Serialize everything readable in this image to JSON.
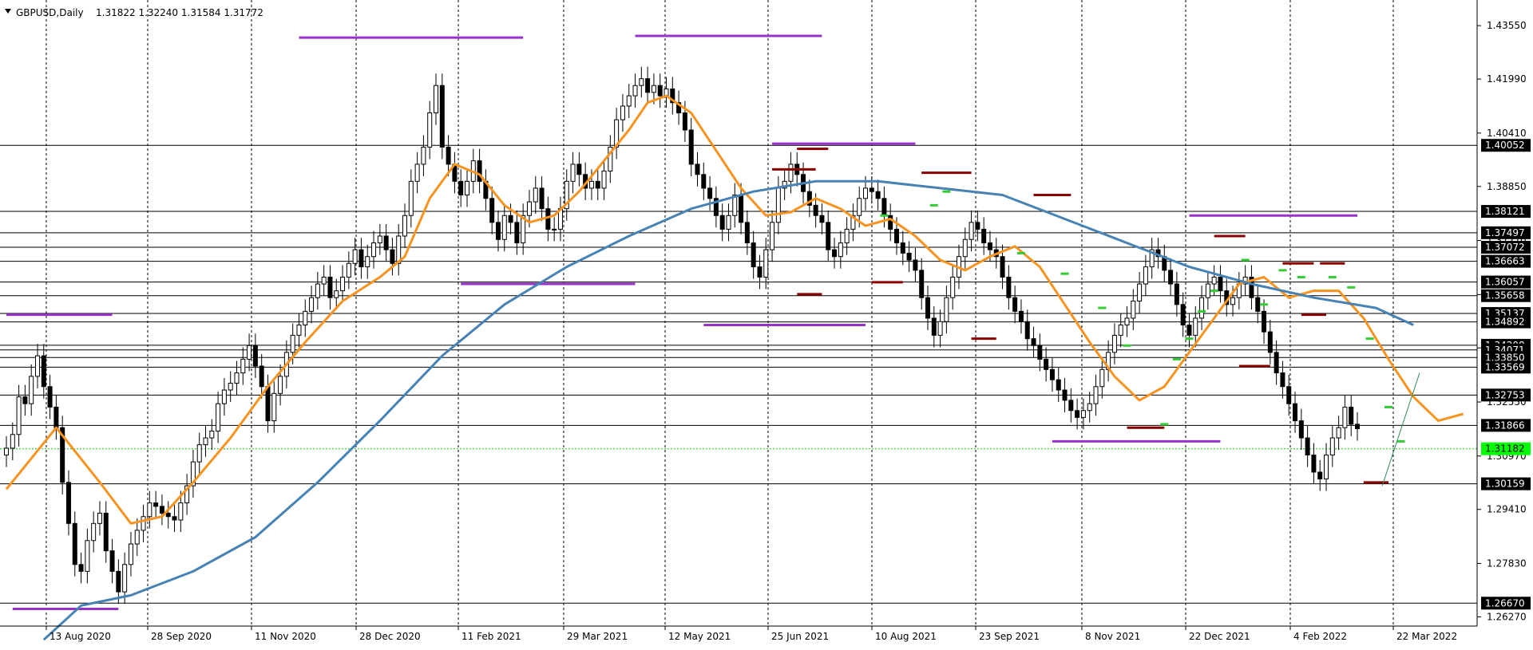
{
  "window": {
    "symbol_title": "GBPUSD,Daily",
    "ohlc": "1.31822 1.32240 1.31584 1.31772",
    "menu_arrow_icon": "triangle-down-icon"
  },
  "colors": {
    "background": "#ffffff",
    "grid": "#000000",
    "candle": "#000000",
    "ma_fast": "#f7931e",
    "ma_slow": "#4682b4",
    "level_line": "#000000",
    "purple_zone": "#9932cc",
    "resistance_marker": "#8b0000",
    "fractal_up": "#32cd32",
    "current_price_bg": "#00ff00",
    "label_bg": "#000000",
    "label_fg": "#ffffff",
    "trend_line": "#2e8b57"
  },
  "chart_data": {
    "type": "candlestick",
    "title": "GBPUSD,Daily",
    "symbol": "GBPUSD",
    "timeframe": "Daily",
    "last_ohlc": {
      "open": 1.31822,
      "high": 1.3224,
      "low": 1.31584,
      "close": 1.31772
    },
    "ylim": [
      1.26,
      1.443
    ],
    "grid": true,
    "y_ticks": [
      "1.43550",
      "1.41990",
      "1.40410",
      "1.38850",
      "1.37270",
      "1.35690",
      "1.34130",
      "1.32550",
      "1.30970",
      "1.29410",
      "1.27830",
      "1.26270"
    ],
    "x_ticks": [
      "13 Aug 2020",
      "28 Sep 2020",
      "11 Nov 2020",
      "28 Dec 2020",
      "11 Feb 2021",
      "29 Mar 2021",
      "12 May 2021",
      "25 Jun 2021",
      "10 Aug 2021",
      "23 Sep 2021",
      "8 Nov 2021",
      "22 Dec 2021",
      "4 Feb 2022",
      "22 Mar 2022"
    ],
    "price_levels": [
      "1.40052",
      "1.38121",
      "1.37497",
      "1.37072",
      "1.36663",
      "1.36057",
      "1.35658",
      "1.35137",
      "1.34892",
      "1.34208",
      "1.34071",
      "1.33850",
      "1.33569",
      "1.32753",
      "1.31866",
      "1.30159",
      "1.26670"
    ],
    "current_price": "1.31182",
    "close_series": [
      1.312,
      1.316,
      1.327,
      1.325,
      1.333,
      1.339,
      1.33,
      1.324,
      1.318,
      1.302,
      1.29,
      1.278,
      1.276,
      1.285,
      1.29,
      1.293,
      1.282,
      1.276,
      1.27,
      1.278,
      1.284,
      1.288,
      1.292,
      1.296,
      1.295,
      1.293,
      1.292,
      1.291,
      1.296,
      1.301,
      1.308,
      1.313,
      1.315,
      1.317,
      1.325,
      1.329,
      1.331,
      1.334,
      1.338,
      1.342,
      1.336,
      1.33,
      1.32,
      1.328,
      1.333,
      1.34,
      1.345,
      1.348,
      1.352,
      1.356,
      1.36,
      1.362,
      1.356,
      1.358,
      1.362,
      1.366,
      1.37,
      1.365,
      1.368,
      1.372,
      1.374,
      1.37,
      1.366,
      1.374,
      1.38,
      1.39,
      1.395,
      1.4,
      1.41,
      1.418,
      1.4,
      1.395,
      1.39,
      1.386,
      1.39,
      1.396,
      1.39,
      1.385,
      1.378,
      1.373,
      1.38,
      1.378,
      1.372,
      1.38,
      1.384,
      1.388,
      1.382,
      1.376,
      1.376,
      1.382,
      1.39,
      1.395,
      1.392,
      1.388,
      1.39,
      1.388,
      1.393,
      1.4,
      1.408,
      1.412,
      1.415,
      1.418,
      1.42,
      1.416,
      1.418,
      1.415,
      1.417,
      1.413,
      1.41,
      1.405,
      1.395,
      1.392,
      1.388,
      1.385,
      1.38,
      1.376,
      1.38,
      1.386,
      1.378,
      1.372,
      1.365,
      1.362,
      1.37,
      1.378,
      1.388,
      1.39,
      1.395,
      1.392,
      1.387,
      1.383,
      1.38,
      1.378,
      1.37,
      1.368,
      1.372,
      1.376,
      1.38,
      1.385,
      1.388,
      1.387,
      1.385,
      1.38,
      1.376,
      1.372,
      1.369,
      1.367,
      1.364,
      1.356,
      1.35,
      1.345,
      1.349,
      1.356,
      1.362,
      1.368,
      1.373,
      1.378,
      1.376,
      1.372,
      1.37,
      1.368,
      1.362,
      1.356,
      1.352,
      1.349,
      1.344,
      1.342,
      1.338,
      1.335,
      1.332,
      1.329,
      1.326,
      1.323,
      1.321,
      1.323,
      1.325,
      1.33,
      1.335,
      1.34,
      1.345,
      1.348,
      1.35,
      1.355,
      1.36,
      1.365,
      1.37,
      1.368,
      1.364,
      1.36,
      1.354,
      1.348,
      1.345,
      1.35,
      1.356,
      1.36,
      1.362,
      1.358,
      1.354,
      1.356,
      1.36,
      1.362,
      1.356,
      1.352,
      1.346,
      1.34,
      1.334,
      1.33,
      1.325,
      1.32,
      1.315,
      1.31,
      1.305,
      1.303,
      1.31,
      1.315,
      1.318,
      1.324,
      1.319,
      1.3177
    ],
    "moving_averages": [
      {
        "name": "",
        "color": "#f7931e",
        "points": [
          [
            0,
            1.3
          ],
          [
            8,
            1.318
          ],
          [
            15,
            1.302
          ],
          [
            20,
            1.29
          ],
          [
            25,
            1.292
          ],
          [
            30,
            1.302
          ],
          [
            36,
            1.315
          ],
          [
            42,
            1.33
          ],
          [
            48,
            1.343
          ],
          [
            54,
            1.355
          ],
          [
            60,
            1.362
          ],
          [
            64,
            1.368
          ],
          [
            68,
            1.385
          ],
          [
            72,
            1.395
          ],
          [
            76,
            1.392
          ],
          [
            80,
            1.383
          ],
          [
            84,
            1.378
          ],
          [
            88,
            1.38
          ],
          [
            92,
            1.387
          ],
          [
            96,
            1.396
          ],
          [
            100,
            1.405
          ],
          [
            103,
            1.413
          ],
          [
            106,
            1.415
          ],
          [
            110,
            1.41
          ],
          [
            114,
            1.399
          ],
          [
            118,
            1.388
          ],
          [
            122,
            1.38
          ],
          [
            126,
            1.381
          ],
          [
            130,
            1.385
          ],
          [
            134,
            1.382
          ],
          [
            138,
            1.377
          ],
          [
            142,
            1.379
          ],
          [
            146,
            1.374
          ],
          [
            150,
            1.367
          ],
          [
            154,
            1.364
          ],
          [
            158,
            1.368
          ],
          [
            162,
            1.371
          ],
          [
            166,
            1.365
          ],
          [
            170,
            1.354
          ],
          [
            174,
            1.343
          ],
          [
            178,
            1.333
          ],
          [
            182,
            1.326
          ],
          [
            186,
            1.33
          ],
          [
            190,
            1.34
          ],
          [
            194,
            1.35
          ],
          [
            198,
            1.36
          ],
          [
            202,
            1.362
          ],
          [
            206,
            1.356
          ],
          [
            210,
            1.358
          ],
          [
            214,
            1.358
          ],
          [
            218,
            1.35
          ],
          [
            222,
            1.338
          ],
          [
            226,
            1.327
          ],
          [
            230,
            1.32
          ],
          [
            234,
            1.322
          ]
        ]
      },
      {
        "name": "",
        "color": "#4682b4",
        "points": [
          [
            6,
            1.256
          ],
          [
            12,
            1.266
          ],
          [
            20,
            1.269
          ],
          [
            30,
            1.276
          ],
          [
            40,
            1.286
          ],
          [
            50,
            1.302
          ],
          [
            60,
            1.32
          ],
          [
            70,
            1.339
          ],
          [
            80,
            1.354
          ],
          [
            90,
            1.365
          ],
          [
            100,
            1.374
          ],
          [
            110,
            1.382
          ],
          [
            120,
            1.387
          ],
          [
            130,
            1.39
          ],
          [
            140,
            1.39
          ],
          [
            150,
            1.388
          ],
          [
            160,
            1.386
          ],
          [
            170,
            1.379
          ],
          [
            180,
            1.372
          ],
          [
            190,
            1.365
          ],
          [
            200,
            1.36
          ],
          [
            210,
            1.356
          ],
          [
            220,
            1.353
          ],
          [
            226,
            1.348
          ]
        ]
      }
    ],
    "purple_zones": [
      {
        "x1": 1,
        "x2": 18,
        "y": 1.265
      },
      {
        "x1": 0,
        "x2": 17,
        "y": 1.351
      },
      {
        "x1": 47,
        "x2": 83,
        "y": 1.432
      },
      {
        "x1": 73,
        "x2": 101,
        "y": 1.36
      },
      {
        "x1": 101,
        "x2": 131,
        "y": 1.4325
      },
      {
        "x1": 112,
        "x2": 138,
        "y": 1.348
      },
      {
        "x1": 123,
        "x2": 146,
        "y": 1.401
      },
      {
        "x1": 168,
        "x2": 195,
        "y": 1.314
      },
      {
        "x1": 190,
        "x2": 217,
        "y": 1.38
      }
    ],
    "resistance_markers": [
      {
        "x1": 123,
        "x2": 130,
        "y": 1.3935
      },
      {
        "x1": 127,
        "x2": 132,
        "y": 1.3995
      },
      {
        "x1": 147,
        "x2": 155,
        "y": 1.3925
      },
      {
        "x1": 165,
        "x2": 171,
        "y": 1.386
      },
      {
        "x1": 127,
        "x2": 131,
        "y": 1.357
      },
      {
        "x1": 139,
        "x2": 144,
        "y": 1.3605
      },
      {
        "x1": 155,
        "x2": 159,
        "y": 1.344
      },
      {
        "x1": 180,
        "x2": 186,
        "y": 1.318
      },
      {
        "x1": 194,
        "x2": 199,
        "y": 1.374
      },
      {
        "x1": 198,
        "x2": 203,
        "y": 1.336
      },
      {
        "x1": 205,
        "x2": 210,
        "y": 1.366
      },
      {
        "x1": 208,
        "x2": 212,
        "y": 1.351
      },
      {
        "x1": 211,
        "x2": 215,
        "y": 1.366
      },
      {
        "x1": 218,
        "x2": 222,
        "y": 1.302
      }
    ],
    "fractal_marks": [
      [
        141,
        1.38
      ],
      [
        149,
        1.383
      ],
      [
        151,
        1.387
      ],
      [
        163,
        1.369
      ],
      [
        170,
        1.363
      ],
      [
        176,
        1.353
      ],
      [
        180,
        1.342
      ],
      [
        186,
        1.319
      ],
      [
        188,
        1.338
      ],
      [
        190,
        1.344
      ],
      [
        192,
        1.352
      ],
      [
        194,
        1.358
      ],
      [
        199,
        1.367
      ],
      [
        202,
        1.354
      ],
      [
        205,
        1.364
      ],
      [
        208,
        1.362
      ],
      [
        213,
        1.362
      ],
      [
        216,
        1.359
      ],
      [
        219,
        1.344
      ],
      [
        222,
        1.324
      ],
      [
        224,
        1.314
      ]
    ]
  }
}
